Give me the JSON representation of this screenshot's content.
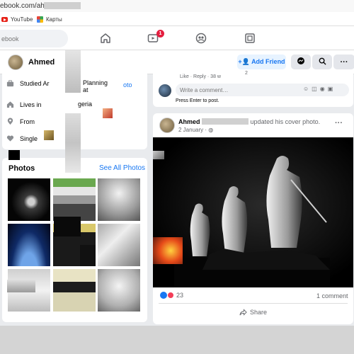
{
  "browser": {
    "url": "ebook.com/ahmed.",
    "bookmarks": [
      {
        "label": "YouTube",
        "icon": "youtube-icon"
      },
      {
        "label": "Карты",
        "icon": "maps-icon"
      }
    ]
  },
  "nav": {
    "search_placeholder": "ebook",
    "notification_count": "1",
    "icons": [
      "home-icon",
      "watch-icon",
      "groups-icon",
      "gaming-icon"
    ]
  },
  "profile_bar": {
    "name": "Ahmed",
    "add_friend": "Add Friend",
    "more": "···"
  },
  "intro": {
    "items": [
      {
        "icon": "briefcase-icon",
        "pre": "Studied Ar",
        "post": "Planning at"
      },
      {
        "icon": "home-icon",
        "pre": "Lives in",
        "post": "geria"
      },
      {
        "icon": "location-icon",
        "pre": "From",
        "post": ""
      },
      {
        "icon": "heart-icon",
        "pre": "Single",
        "post": ""
      }
    ],
    "fragment": "oto"
  },
  "photos": {
    "title": "Photos",
    "see_all": "See All Photos"
  },
  "comments": {
    "actions": "Like · Reply · 38 w",
    "reaction_count": "2",
    "placeholder": "Write a comment…",
    "hint": "Press Enter to post."
  },
  "post": {
    "author": "Ahmed",
    "action": "updated his cover photo.",
    "date": "2 January · ",
    "reactions_count": "23",
    "comments_count": "1 comment",
    "share": "Share"
  },
  "colors": {
    "accent": "#1877f2",
    "badge": "#e41e3f",
    "like": "#1877f2",
    "love": "#f33e58"
  }
}
